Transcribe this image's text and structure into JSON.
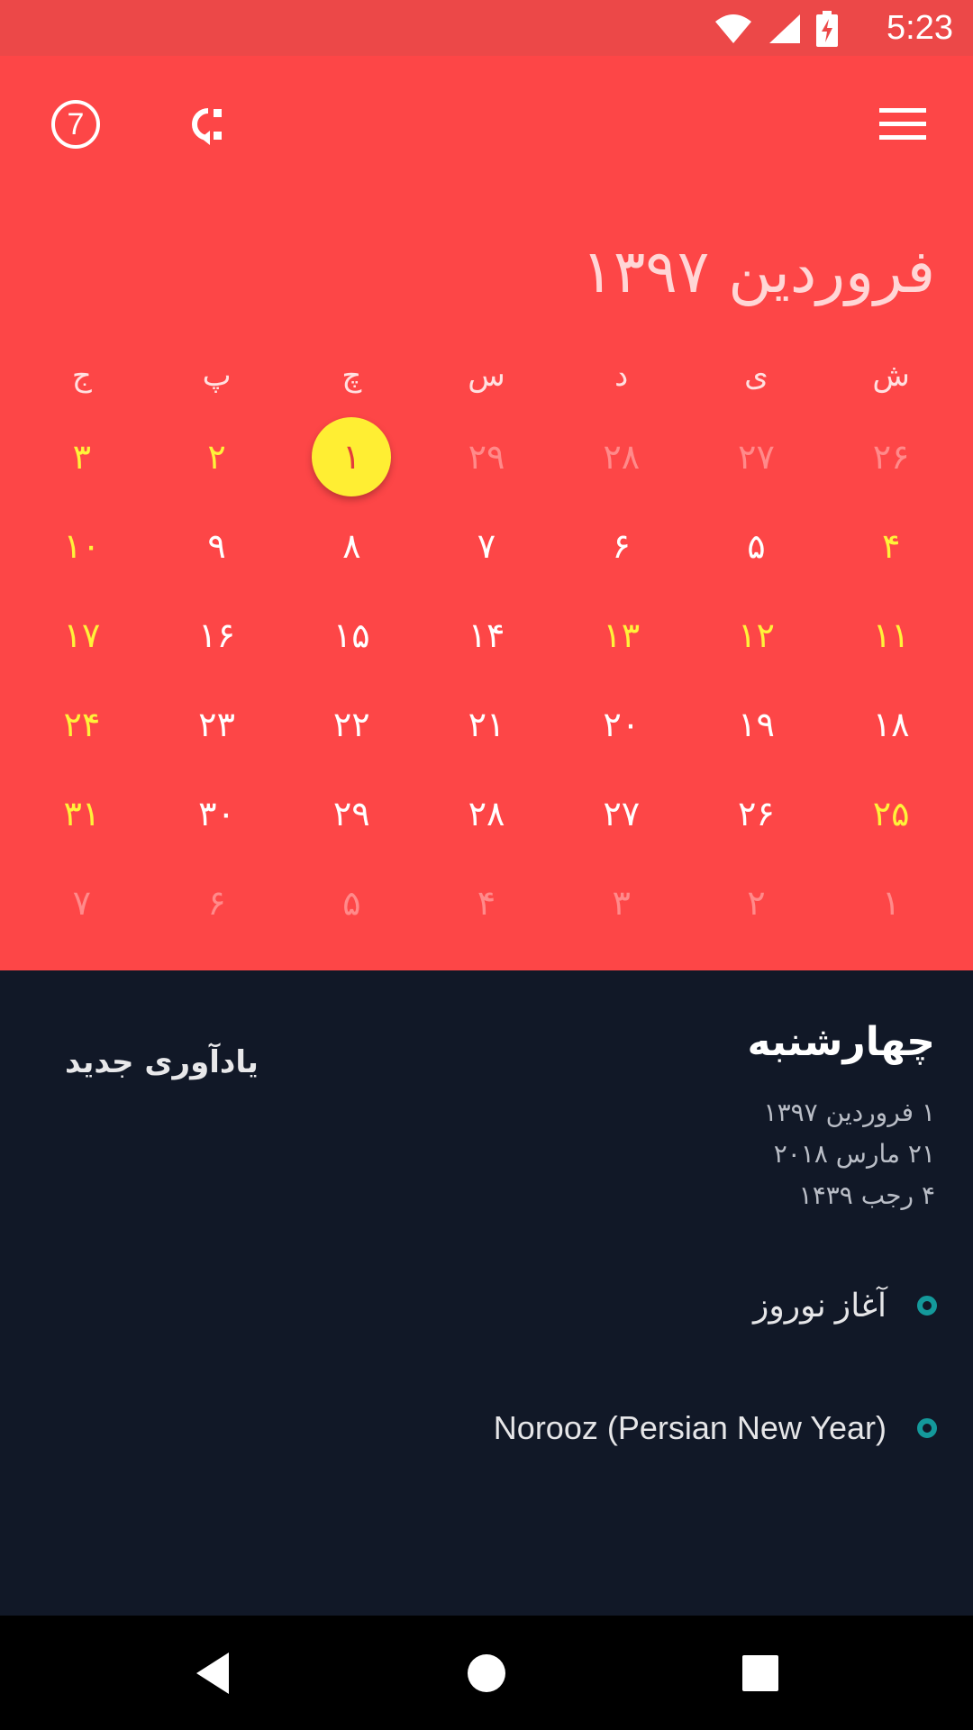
{
  "status_bar": {
    "time": "5:23"
  },
  "toolbar": {
    "today_badge": "7"
  },
  "calendar": {
    "month_title": "فروردین ۱۳۹۷",
    "weekdays": [
      "ش",
      "ی",
      "د",
      "س",
      "چ",
      "پ",
      "ج"
    ],
    "days": [
      {
        "t": "۲۶",
        "s": "out"
      },
      {
        "t": "۲۷",
        "s": "out"
      },
      {
        "t": "۲۸",
        "s": "out"
      },
      {
        "t": "۲۹",
        "s": "out"
      },
      {
        "t": "۱",
        "s": "selected"
      },
      {
        "t": "۲",
        "s": "holiday"
      },
      {
        "t": "۳",
        "s": "holiday"
      },
      {
        "t": "۴",
        "s": "holiday"
      },
      {
        "t": "۵",
        "s": "normal"
      },
      {
        "t": "۶",
        "s": "normal"
      },
      {
        "t": "۷",
        "s": "normal"
      },
      {
        "t": "۸",
        "s": "normal"
      },
      {
        "t": "۹",
        "s": "normal"
      },
      {
        "t": "۱۰",
        "s": "holiday"
      },
      {
        "t": "۱۱",
        "s": "holiday"
      },
      {
        "t": "۱۲",
        "s": "holiday"
      },
      {
        "t": "۱۳",
        "s": "holiday"
      },
      {
        "t": "۱۴",
        "s": "normal"
      },
      {
        "t": "۱۵",
        "s": "normal"
      },
      {
        "t": "۱۶",
        "s": "normal"
      },
      {
        "t": "۱۷",
        "s": "holiday"
      },
      {
        "t": "۱۸",
        "s": "normal"
      },
      {
        "t": "۱۹",
        "s": "normal"
      },
      {
        "t": "۲۰",
        "s": "normal"
      },
      {
        "t": "۲۱",
        "s": "normal"
      },
      {
        "t": "۲۲",
        "s": "normal"
      },
      {
        "t": "۲۳",
        "s": "normal"
      },
      {
        "t": "۲۴",
        "s": "holiday"
      },
      {
        "t": "۲۵",
        "s": "holiday"
      },
      {
        "t": "۲۶",
        "s": "normal"
      },
      {
        "t": "۲۷",
        "s": "normal"
      },
      {
        "t": "۲۸",
        "s": "normal"
      },
      {
        "t": "۲۹",
        "s": "normal"
      },
      {
        "t": "۳۰",
        "s": "normal"
      },
      {
        "t": "۳۱",
        "s": "holiday"
      },
      {
        "t": "۱",
        "s": "out"
      },
      {
        "t": "۲",
        "s": "out"
      },
      {
        "t": "۳",
        "s": "out"
      },
      {
        "t": "۴",
        "s": "out"
      },
      {
        "t": "۵",
        "s": "out"
      },
      {
        "t": "۶",
        "s": "out"
      },
      {
        "t": "۷",
        "s": "out"
      }
    ]
  },
  "details": {
    "weekday_name": "چهارشنبه",
    "date_lines": [
      "۱ فروردین ۱۳۹۷",
      "۲۱ مارس ۲۰۱۸",
      "۴ رجب ۱۴۳۹"
    ],
    "new_reminder_label": "یادآوری جدید",
    "events": [
      "آغاز نوروز",
      "Norooz (Persian New Year)"
    ]
  },
  "colors": {
    "header_bg": "#FD4647",
    "status_bg": "#EC4848",
    "selected_day": "#FFEE33",
    "holiday_text": "#FFF23A",
    "details_bg": "#111827",
    "event_dot": "#14999B"
  },
  "icons": {
    "toolbar": [
      "today-icon",
      "convert-icon",
      "menu-icon"
    ],
    "status": [
      "wifi-icon",
      "signal-icon",
      "battery-charging-icon"
    ],
    "nav": [
      "back-icon",
      "home-icon",
      "recents-icon"
    ]
  }
}
